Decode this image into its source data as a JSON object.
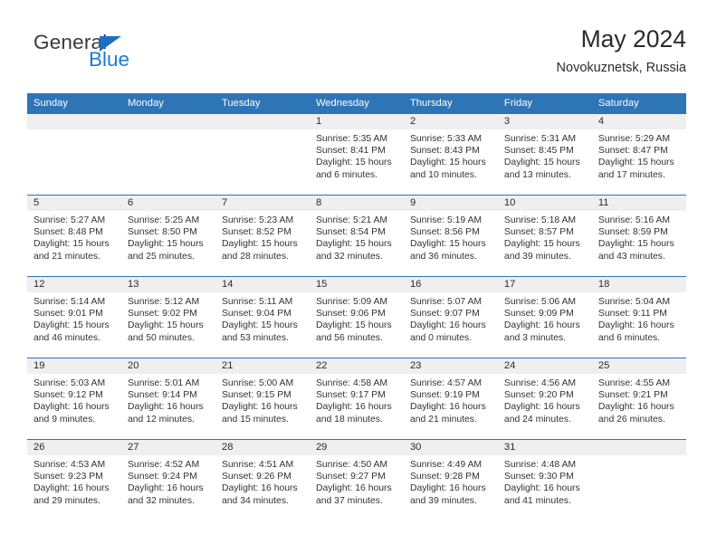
{
  "brand": {
    "name_top": "General",
    "name_bottom": "Blue",
    "triangle_color": "#1E6FBF",
    "blue_color": "#1E7AD1"
  },
  "header": {
    "title": "May 2024",
    "subtitle": "Novokuznetsk, Russia"
  },
  "theme": {
    "header_blue": "#2E75B6",
    "daynum_gray": "#EFEFEF",
    "text": "#333333"
  },
  "calendar": {
    "weekday_headers": [
      "Sunday",
      "Monday",
      "Tuesday",
      "Wednesday",
      "Thursday",
      "Friday",
      "Saturday"
    ],
    "labels": {
      "sunrise": "Sunrise:",
      "sunset": "Sunset:",
      "daylight": "Daylight:"
    },
    "weeks": [
      [
        {
          "day": "",
          "sunrise": "",
          "sunset": "",
          "daylight_line1": "",
          "daylight_line2": ""
        },
        {
          "day": "",
          "sunrise": "",
          "sunset": "",
          "daylight_line1": "",
          "daylight_line2": ""
        },
        {
          "day": "",
          "sunrise": "",
          "sunset": "",
          "daylight_line1": "",
          "daylight_line2": ""
        },
        {
          "day": "1",
          "sunrise": "Sunrise: 5:35 AM",
          "sunset": "Sunset: 8:41 PM",
          "daylight_line1": "Daylight: 15 hours",
          "daylight_line2": "and 6 minutes."
        },
        {
          "day": "2",
          "sunrise": "Sunrise: 5:33 AM",
          "sunset": "Sunset: 8:43 PM",
          "daylight_line1": "Daylight: 15 hours",
          "daylight_line2": "and 10 minutes."
        },
        {
          "day": "3",
          "sunrise": "Sunrise: 5:31 AM",
          "sunset": "Sunset: 8:45 PM",
          "daylight_line1": "Daylight: 15 hours",
          "daylight_line2": "and 13 minutes."
        },
        {
          "day": "4",
          "sunrise": "Sunrise: 5:29 AM",
          "sunset": "Sunset: 8:47 PM",
          "daylight_line1": "Daylight: 15 hours",
          "daylight_line2": "and 17 minutes."
        }
      ],
      [
        {
          "day": "5",
          "sunrise": "Sunrise: 5:27 AM",
          "sunset": "Sunset: 8:48 PM",
          "daylight_line1": "Daylight: 15 hours",
          "daylight_line2": "and 21 minutes."
        },
        {
          "day": "6",
          "sunrise": "Sunrise: 5:25 AM",
          "sunset": "Sunset: 8:50 PM",
          "daylight_line1": "Daylight: 15 hours",
          "daylight_line2": "and 25 minutes."
        },
        {
          "day": "7",
          "sunrise": "Sunrise: 5:23 AM",
          "sunset": "Sunset: 8:52 PM",
          "daylight_line1": "Daylight: 15 hours",
          "daylight_line2": "and 28 minutes."
        },
        {
          "day": "8",
          "sunrise": "Sunrise: 5:21 AM",
          "sunset": "Sunset: 8:54 PM",
          "daylight_line1": "Daylight: 15 hours",
          "daylight_line2": "and 32 minutes."
        },
        {
          "day": "9",
          "sunrise": "Sunrise: 5:19 AM",
          "sunset": "Sunset: 8:56 PM",
          "daylight_line1": "Daylight: 15 hours",
          "daylight_line2": "and 36 minutes."
        },
        {
          "day": "10",
          "sunrise": "Sunrise: 5:18 AM",
          "sunset": "Sunset: 8:57 PM",
          "daylight_line1": "Daylight: 15 hours",
          "daylight_line2": "and 39 minutes."
        },
        {
          "day": "11",
          "sunrise": "Sunrise: 5:16 AM",
          "sunset": "Sunset: 8:59 PM",
          "daylight_line1": "Daylight: 15 hours",
          "daylight_line2": "and 43 minutes."
        }
      ],
      [
        {
          "day": "12",
          "sunrise": "Sunrise: 5:14 AM",
          "sunset": "Sunset: 9:01 PM",
          "daylight_line1": "Daylight: 15 hours",
          "daylight_line2": "and 46 minutes."
        },
        {
          "day": "13",
          "sunrise": "Sunrise: 5:12 AM",
          "sunset": "Sunset: 9:02 PM",
          "daylight_line1": "Daylight: 15 hours",
          "daylight_line2": "and 50 minutes."
        },
        {
          "day": "14",
          "sunrise": "Sunrise: 5:11 AM",
          "sunset": "Sunset: 9:04 PM",
          "daylight_line1": "Daylight: 15 hours",
          "daylight_line2": "and 53 minutes."
        },
        {
          "day": "15",
          "sunrise": "Sunrise: 5:09 AM",
          "sunset": "Sunset: 9:06 PM",
          "daylight_line1": "Daylight: 15 hours",
          "daylight_line2": "and 56 minutes."
        },
        {
          "day": "16",
          "sunrise": "Sunrise: 5:07 AM",
          "sunset": "Sunset: 9:07 PM",
          "daylight_line1": "Daylight: 16 hours",
          "daylight_line2": "and 0 minutes."
        },
        {
          "day": "17",
          "sunrise": "Sunrise: 5:06 AM",
          "sunset": "Sunset: 9:09 PM",
          "daylight_line1": "Daylight: 16 hours",
          "daylight_line2": "and 3 minutes."
        },
        {
          "day": "18",
          "sunrise": "Sunrise: 5:04 AM",
          "sunset": "Sunset: 9:11 PM",
          "daylight_line1": "Daylight: 16 hours",
          "daylight_line2": "and 6 minutes."
        }
      ],
      [
        {
          "day": "19",
          "sunrise": "Sunrise: 5:03 AM",
          "sunset": "Sunset: 9:12 PM",
          "daylight_line1": "Daylight: 16 hours",
          "daylight_line2": "and 9 minutes."
        },
        {
          "day": "20",
          "sunrise": "Sunrise: 5:01 AM",
          "sunset": "Sunset: 9:14 PM",
          "daylight_line1": "Daylight: 16 hours",
          "daylight_line2": "and 12 minutes."
        },
        {
          "day": "21",
          "sunrise": "Sunrise: 5:00 AM",
          "sunset": "Sunset: 9:15 PM",
          "daylight_line1": "Daylight: 16 hours",
          "daylight_line2": "and 15 minutes."
        },
        {
          "day": "22",
          "sunrise": "Sunrise: 4:58 AM",
          "sunset": "Sunset: 9:17 PM",
          "daylight_line1": "Daylight: 16 hours",
          "daylight_line2": "and 18 minutes."
        },
        {
          "day": "23",
          "sunrise": "Sunrise: 4:57 AM",
          "sunset": "Sunset: 9:19 PM",
          "daylight_line1": "Daylight: 16 hours",
          "daylight_line2": "and 21 minutes."
        },
        {
          "day": "24",
          "sunrise": "Sunrise: 4:56 AM",
          "sunset": "Sunset: 9:20 PM",
          "daylight_line1": "Daylight: 16 hours",
          "daylight_line2": "and 24 minutes."
        },
        {
          "day": "25",
          "sunrise": "Sunrise: 4:55 AM",
          "sunset": "Sunset: 9:21 PM",
          "daylight_line1": "Daylight: 16 hours",
          "daylight_line2": "and 26 minutes."
        }
      ],
      [
        {
          "day": "26",
          "sunrise": "Sunrise: 4:53 AM",
          "sunset": "Sunset: 9:23 PM",
          "daylight_line1": "Daylight: 16 hours",
          "daylight_line2": "and 29 minutes."
        },
        {
          "day": "27",
          "sunrise": "Sunrise: 4:52 AM",
          "sunset": "Sunset: 9:24 PM",
          "daylight_line1": "Daylight: 16 hours",
          "daylight_line2": "and 32 minutes."
        },
        {
          "day": "28",
          "sunrise": "Sunrise: 4:51 AM",
          "sunset": "Sunset: 9:26 PM",
          "daylight_line1": "Daylight: 16 hours",
          "daylight_line2": "and 34 minutes."
        },
        {
          "day": "29",
          "sunrise": "Sunrise: 4:50 AM",
          "sunset": "Sunset: 9:27 PM",
          "daylight_line1": "Daylight: 16 hours",
          "daylight_line2": "and 37 minutes."
        },
        {
          "day": "30",
          "sunrise": "Sunrise: 4:49 AM",
          "sunset": "Sunset: 9:28 PM",
          "daylight_line1": "Daylight: 16 hours",
          "daylight_line2": "and 39 minutes."
        },
        {
          "day": "31",
          "sunrise": "Sunrise: 4:48 AM",
          "sunset": "Sunset: 9:30 PM",
          "daylight_line1": "Daylight: 16 hours",
          "daylight_line2": "and 41 minutes."
        },
        {
          "day": "",
          "sunrise": "",
          "sunset": "",
          "daylight_line1": "",
          "daylight_line2": ""
        }
      ]
    ]
  }
}
